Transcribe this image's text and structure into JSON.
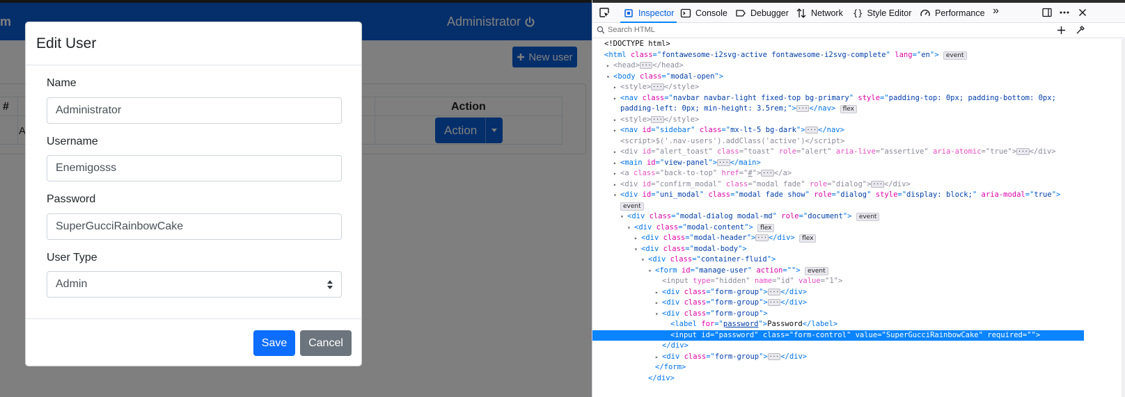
{
  "webpage": {
    "brand_partial": "m",
    "nav_user": "Administrator",
    "new_user_button": "New user",
    "table": {
      "col_hash": "#",
      "col_action": "Action",
      "row_partial": "A",
      "action_button": "Action"
    },
    "modal": {
      "title": "Edit User",
      "fields": [
        {
          "label": "Name",
          "value": "Administrator"
        },
        {
          "label": "Username",
          "value": "Enemigosss"
        },
        {
          "label": "Password",
          "value": "SuperGucciRainbowCake"
        }
      ],
      "user_type": {
        "label": "User Type",
        "selected": "Admin"
      },
      "save_label": "Save",
      "cancel_label": "Cancel"
    }
  },
  "devtools": {
    "tabs": [
      "Inspector",
      "Console",
      "Debugger",
      "Network",
      "Style Editor",
      "Performance"
    ],
    "selected_tab": "Inspector",
    "search_placeholder": "Search HTML",
    "tree": {
      "doctype": "<!DOCTYPE html>",
      "html_class": "fontawesome-i2svg-active fontawesome-i2svg-complete",
      "html_lang": "en",
      "body_class": "modal-open",
      "nav_class": "navbar navbar-light fixed-top bg-primary",
      "nav_style_1": "padding-top: 0px; padding-bottom: 0px;",
      "nav_style_2": "padding-left: 0px; min-height: 3.5rem;",
      "sidebar_class": "mx-lt-5 bg-dark",
      "script_text": "$('.nav-users').addClass('active')",
      "toast_id": "alert_toast",
      "toast_class": "toast",
      "toast_role": "alert",
      "toast_live": "assertive",
      "toast_atomic": "true",
      "main_id": "view-panel",
      "a_class": "back-to-top",
      "a_href": "#",
      "confirm_id": "confirm_modal",
      "confirm_class": "modal fade",
      "dialog_role": "dialog",
      "uni_id": "uni_modal",
      "uni_class": "modal fade show",
      "uni_style": "display: block;",
      "uni_aria": "true",
      "dialog_class": "modal-dialog modal-md",
      "document_role": "document",
      "content_class": "modal-content",
      "header_class": "modal-header",
      "body_div_class": "modal-body",
      "container_class": "container-fluid",
      "form_id": "manage-user",
      "form_action": "",
      "hidden_type": "hidden",
      "hidden_name": "id",
      "hidden_value": "1",
      "group_class": "form-group",
      "label_for": "password",
      "label_text": "Password",
      "input_id": "password",
      "input_class": "form-control",
      "input_value": "SuperGucciRainbowCake",
      "input_required": "",
      "badge_event": "event",
      "badge_flex": "flex"
    }
  }
}
